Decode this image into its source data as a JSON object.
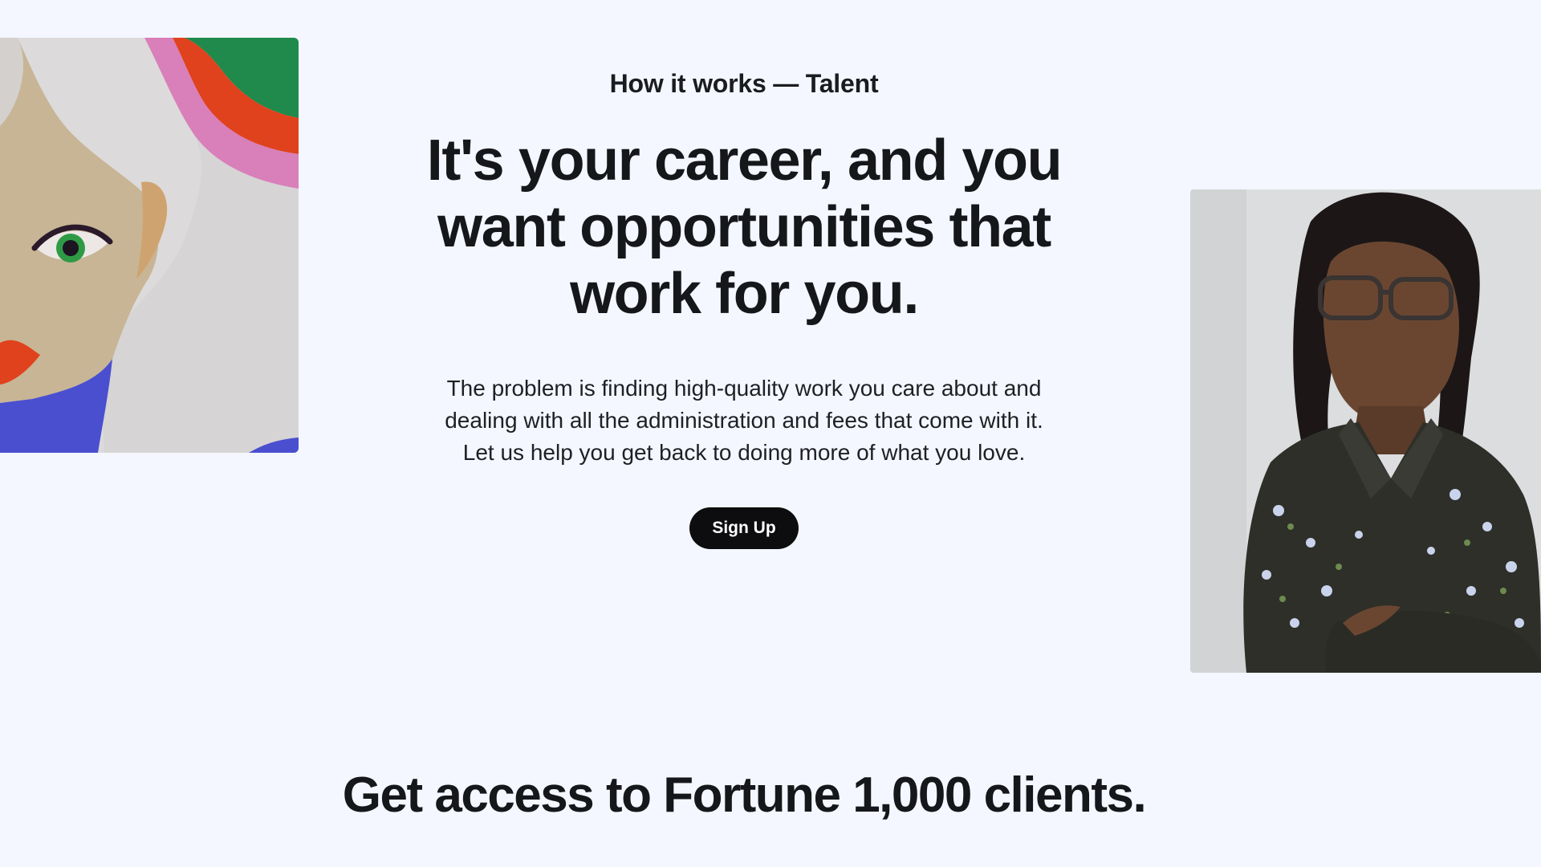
{
  "hero": {
    "eyebrow": "How it works — Talent",
    "headline": "It's your career, and you want opportunities that work for you.",
    "lead": "The problem is finding high-quality work you care about and dealing with all the administration and fees that come with it. Let us help you get back to doing more of what you love.",
    "cta_label": "Sign Up"
  },
  "clients": {
    "title": "Get access to Fortune 1,000 clients."
  },
  "colors": {
    "background": "#f4f7ff",
    "text": "#16171b",
    "button": "#0d0d0f",
    "button_text": "#ffffff"
  }
}
